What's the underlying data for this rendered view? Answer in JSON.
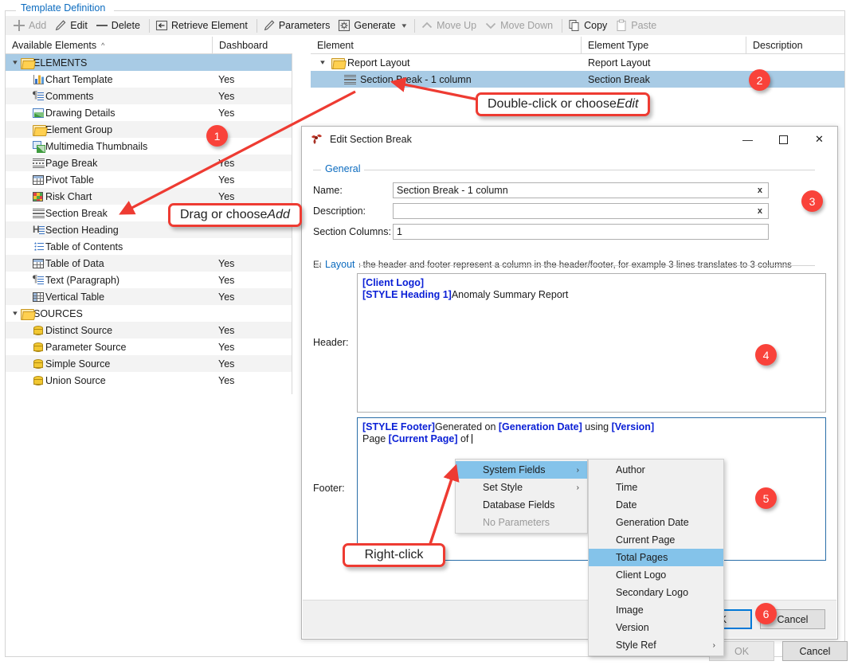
{
  "group": {
    "title": "Template Definition"
  },
  "toolbar": {
    "items": [
      {
        "label": "Add",
        "icon": "plus-icon",
        "disabled": true
      },
      {
        "label": "Edit",
        "icon": "pencil-icon",
        "disabled": false
      },
      {
        "label": "Delete",
        "icon": "minus-icon",
        "disabled": false
      },
      {
        "label": "Retrieve Element",
        "icon": "retrieve-icon",
        "disabled": false
      },
      {
        "label": "Parameters",
        "icon": "pencil-icon",
        "disabled": false
      },
      {
        "label": "Generate",
        "icon": "gear-icon",
        "disabled": false,
        "dropdown": true
      },
      {
        "label": "Move Up",
        "icon": "chevron-up-icon",
        "disabled": true
      },
      {
        "label": "Move Down",
        "icon": "chevron-down-icon",
        "disabled": true
      },
      {
        "label": "Copy",
        "icon": "copy-icon",
        "disabled": false
      },
      {
        "label": "Paste",
        "icon": "paste-icon",
        "disabled": true
      }
    ]
  },
  "left_panel": {
    "columns": [
      "Available Elements",
      "Dashboard"
    ],
    "sort_indicator": "^",
    "rows": [
      {
        "label": "ELEMENTS",
        "dashboard": "",
        "icon": "folder-open-icon",
        "level": 0,
        "expanded": true,
        "selected": true
      },
      {
        "label": "Chart Template",
        "dashboard": "Yes",
        "icon": "chart-icon",
        "level": 1
      },
      {
        "label": "Comments",
        "dashboard": "Yes",
        "icon": "paragraph-icon",
        "level": 1
      },
      {
        "label": "Drawing Details",
        "dashboard": "Yes",
        "icon": "image-icon",
        "level": 1
      },
      {
        "label": "Element Group",
        "dashboard": "",
        "icon": "folder-icon",
        "level": 1
      },
      {
        "label": "Multimedia Thumbnails",
        "dashboard": "",
        "icon": "multimedia-icon",
        "level": 1
      },
      {
        "label": "Page Break",
        "dashboard": "Yes",
        "icon": "page-break-icon",
        "level": 1
      },
      {
        "label": "Pivot Table",
        "dashboard": "Yes",
        "icon": "table-icon",
        "level": 1
      },
      {
        "label": "Risk Chart",
        "dashboard": "Yes",
        "icon": "risk-chart-icon",
        "level": 1
      },
      {
        "label": "Section Break",
        "dashboard": "",
        "icon": "section-break-icon",
        "level": 1
      },
      {
        "label": "Section Heading",
        "dashboard": "",
        "icon": "section-heading-icon",
        "level": 1
      },
      {
        "label": "Table of Contents",
        "dashboard": "",
        "icon": "toc-icon",
        "level": 1
      },
      {
        "label": "Table of Data",
        "dashboard": "Yes",
        "icon": "table-icon",
        "level": 1
      },
      {
        "label": "Text (Paragraph)",
        "dashboard": "Yes",
        "icon": "paragraph-icon",
        "level": 1
      },
      {
        "label": "Vertical Table",
        "dashboard": "Yes",
        "icon": "vertical-table-icon",
        "level": 1
      },
      {
        "label": "SOURCES",
        "dashboard": "",
        "icon": "folder-open-icon",
        "level": 0,
        "expanded": true
      },
      {
        "label": "Distinct Source",
        "dashboard": "Yes",
        "icon": "database-icon",
        "level": 1
      },
      {
        "label": "Parameter Source",
        "dashboard": "Yes",
        "icon": "database-icon",
        "level": 1
      },
      {
        "label": "Simple Source",
        "dashboard": "Yes",
        "icon": "database-icon",
        "level": 1
      },
      {
        "label": "Union Source",
        "dashboard": "Yes",
        "icon": "database-icon",
        "level": 1
      }
    ]
  },
  "right_panel": {
    "columns": [
      "Element",
      "Element Type",
      "Description"
    ],
    "rows": [
      {
        "element": "Report Layout",
        "type": "Report Layout",
        "description": "",
        "icon": "folder-icon",
        "level": 0,
        "expanded": true,
        "selected": false
      },
      {
        "element": "Section Break - 1 column",
        "type": "Section Break",
        "description": "",
        "icon": "section-break-icon",
        "level": 1,
        "selected": true
      }
    ]
  },
  "dialog": {
    "title": "Edit Section Break",
    "window_controls": {
      "minimize": "—",
      "maximize": "☐",
      "close": "✕"
    },
    "general": {
      "legend": "General",
      "fields": [
        {
          "label": "Name:",
          "value": "Section Break - 1 column",
          "clear": "x",
          "clearable": true
        },
        {
          "label": "Description:",
          "value": "",
          "clear": "x",
          "clearable": true
        },
        {
          "label": "Section Columns:",
          "value": "1",
          "clearable": false
        }
      ]
    },
    "layout": {
      "legend": "Layout",
      "hint": "Each line in the header and footer represent a column in the header/footer, for example 3 lines translates to 3 columns",
      "header_label": "Header:",
      "header_lines": [
        [
          {
            "t": "[Client Logo]",
            "b": true
          }
        ],
        [
          {
            "t": "[STYLE Heading 1]",
            "b": true
          },
          {
            "t": "Anomaly Summary Report",
            "b": false
          }
        ]
      ],
      "footer_label": "Footer:",
      "footer_lines": [
        [
          {
            "t": "[STYLE Footer]",
            "b": true
          },
          {
            "t": "Generated on ",
            "b": false
          },
          {
            "t": "[Generation Date]",
            "b": true
          },
          {
            "t": " using ",
            "b": false
          },
          {
            "t": "[Version]",
            "b": true
          }
        ],
        [
          {
            "t": "Page ",
            "b": false
          },
          {
            "t": "[Current Page]",
            "b": true
          },
          {
            "t": " of ",
            "b": false
          }
        ]
      ]
    },
    "buttons": {
      "ok": "OK",
      "cancel": "Cancel"
    }
  },
  "context_menu": {
    "primary": [
      {
        "label": "System Fields",
        "submenu": true,
        "highlighted": true,
        "disabled": false
      },
      {
        "label": "Set Style",
        "submenu": true,
        "highlighted": false,
        "disabled": false
      },
      {
        "label": "Database Fields",
        "submenu": false,
        "highlighted": false,
        "disabled": false
      },
      {
        "label": "No Parameters",
        "submenu": false,
        "highlighted": false,
        "disabled": true
      }
    ],
    "submenu": [
      {
        "label": "Author",
        "submenu": false,
        "highlighted": false
      },
      {
        "label": "Time",
        "submenu": false,
        "highlighted": false
      },
      {
        "label": "Date",
        "submenu": false,
        "highlighted": false
      },
      {
        "label": "Generation Date",
        "submenu": false,
        "highlighted": false
      },
      {
        "label": "Current Page",
        "submenu": false,
        "highlighted": false
      },
      {
        "label": "Total Pages",
        "submenu": false,
        "highlighted": true
      },
      {
        "label": "Client Logo",
        "submenu": false,
        "highlighted": false
      },
      {
        "label": "Secondary Logo",
        "submenu": false,
        "highlighted": false
      },
      {
        "label": "Image",
        "submenu": false,
        "highlighted": false
      },
      {
        "label": "Version",
        "submenu": false,
        "highlighted": false
      },
      {
        "label": "Style Ref",
        "submenu": true,
        "highlighted": false
      }
    ]
  },
  "host_buttons": {
    "ok": "OK",
    "cancel": "Cancel"
  },
  "annotations": {
    "badges": [
      "1",
      "2",
      "3",
      "4",
      "5",
      "6"
    ],
    "callouts": [
      {
        "text_before": "Drag or choose ",
        "text_italic": "Add"
      },
      {
        "text_before": "Double-click or choose ",
        "text_italic": "Edit"
      },
      {
        "text_before": "Right-click",
        "text_italic": ""
      }
    ],
    "accent_color": "#f9423a",
    "callout_border_color": "#ee3b32"
  }
}
